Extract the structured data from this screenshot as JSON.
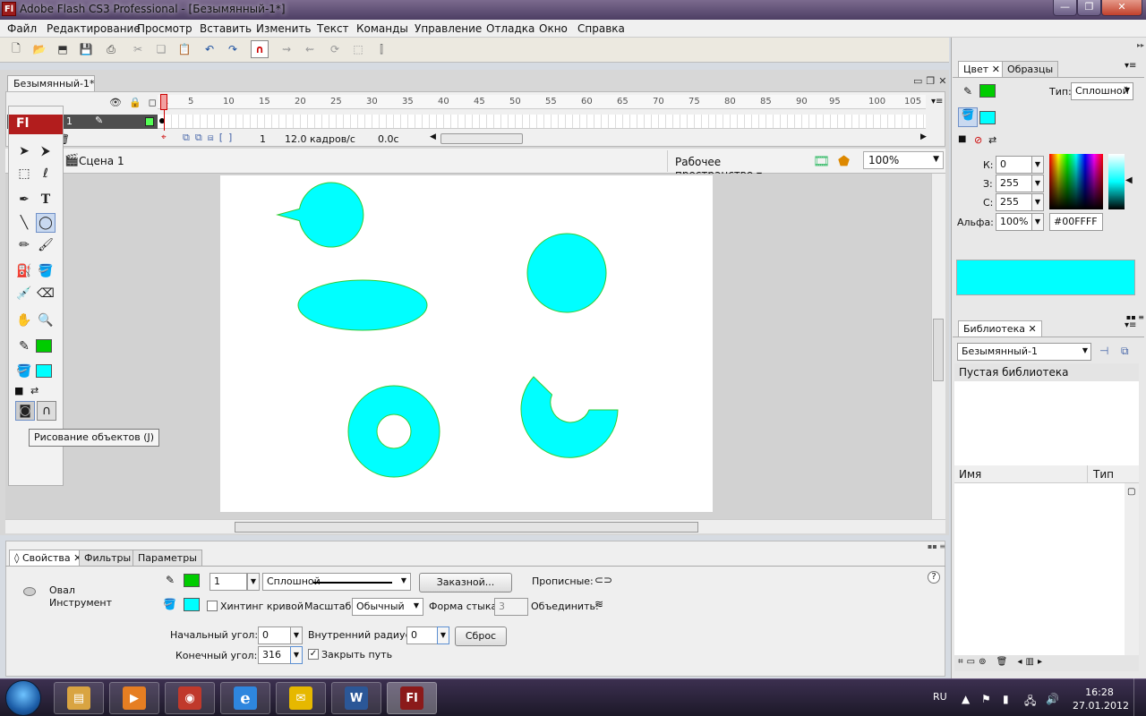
{
  "window": {
    "title": "Adobe Flash CS3 Professional - [Безымянный-1*]",
    "app_icon": "Fl",
    "min": "—",
    "max": "❐",
    "close": "✕"
  },
  "menu": [
    "Файл",
    "Редактирование",
    "Просмотр",
    "Вставить",
    "Изменить",
    "Текст",
    "Команды",
    "Управление",
    "Отладка",
    "Окно",
    "Справка"
  ],
  "toolbar": {
    "icons": [
      "new-icon",
      "open-icon",
      "bridge-icon",
      "save-icon",
      "print-icon",
      "cut-icon",
      "copy-icon",
      "paste-icon",
      "undo-icon",
      "redo-icon",
      "snap-magnet-icon",
      "smooth-icon",
      "straighten-icon",
      "rotate-icon",
      "scale-icon",
      "align-icon"
    ]
  },
  "document": {
    "tab": "Безымянный-1*",
    "scene": "Сцена 1",
    "workspace": "Рабочее пространство",
    "zoom": "100%"
  },
  "timeline": {
    "ruler": [
      "1",
      "5",
      "10",
      "15",
      "20",
      "25",
      "30",
      "35",
      "40",
      "45",
      "50",
      "55",
      "60",
      "65",
      "70",
      "75",
      "80",
      "85",
      "90",
      "95",
      "100",
      "105"
    ],
    "layer_name": "1",
    "current_frame": "1",
    "fps": "12.0 кадров/с",
    "time": "0.0с"
  },
  "tools": {
    "logo": "Fl",
    "tooltip": "Рисование объектов (J)",
    "stroke_color": "#00cc00",
    "fill_color": "#00ffff"
  },
  "stage": {
    "fill": "#00ffff",
    "stroke": "#33cc33"
  },
  "properties": {
    "tabs": [
      "Свойства",
      "Фильтры",
      "Параметры"
    ],
    "tool_name": "Овал",
    "tool_sub": "Инструмент",
    "stroke_width": "1",
    "stroke_style": "Сплошной",
    "custom_btn": "Заказной...",
    "caps_label": "Прописные:",
    "hinting": "Хинтинг кривой",
    "scale_label": "Масштаб:",
    "scale_value": "Обычный",
    "join_label": "Форма стыка:",
    "join_value": "3",
    "combine_label": "Объединить:",
    "start_angle_label": "Начальный угол:",
    "start_angle": "0",
    "inner_radius_label": "Внутренний радиус:",
    "inner_radius": "0",
    "reset_btn": "Сброс",
    "end_angle_label": "Конечный угол:",
    "end_angle": "316",
    "close_path": "Закрыть путь",
    "help": "?"
  },
  "color_panel": {
    "tabs": [
      "Цвет",
      "Образцы"
    ],
    "type_label": "Тип:",
    "type_value": "Сплошной",
    "r_label": "К:",
    "r": "0",
    "g_label": "З:",
    "g": "255",
    "b_label": "С:",
    "b": "255",
    "alpha_label": "Альфа:",
    "alpha": "100%",
    "hex": "#00FFFF",
    "preview": "#00ffff"
  },
  "library": {
    "tab": "Библиотека",
    "doc": "Безымянный-1",
    "empty": "Пустая библиотека",
    "col_name": "Имя",
    "col_type": "Тип"
  },
  "taskbar": {
    "apps": [
      {
        "name": "explorer",
        "color": "#d9a441",
        "glyph": "▤"
      },
      {
        "name": "media",
        "color": "#e67e22",
        "glyph": "▶"
      },
      {
        "name": "recorder",
        "color": "#c0392b",
        "glyph": "◉"
      },
      {
        "name": "ie",
        "color": "#2e86de",
        "glyph": "e"
      },
      {
        "name": "outlook",
        "color": "#e6b800",
        "glyph": "✉"
      },
      {
        "name": "word",
        "color": "#2b5797",
        "glyph": "W"
      },
      {
        "name": "flash",
        "color": "#8b1a1a",
        "glyph": "Fl"
      }
    ],
    "lang": "RU",
    "time": "16:28",
    "date": "27.01.2012"
  }
}
